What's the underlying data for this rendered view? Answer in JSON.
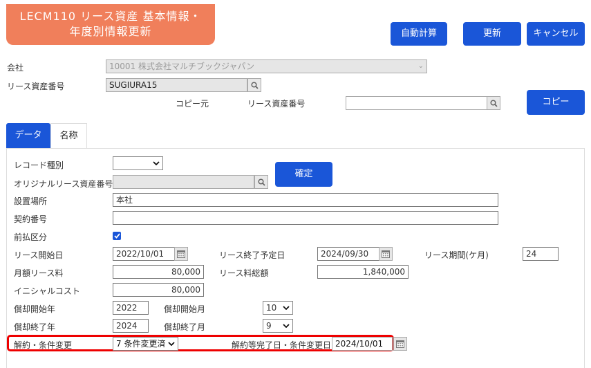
{
  "header": {
    "title_line1": "LECM110 リース資産 基本情報・",
    "title_line2": "年度別情報更新",
    "auto_calc_label": "自動計算",
    "update_label": "更新",
    "cancel_label": "キャンセル"
  },
  "company": {
    "label": "会社",
    "value": "10001 株式会社マルチブックジャパン"
  },
  "asset_no": {
    "label": "リース資産番号",
    "value": "SUGIURA15"
  },
  "copy_source": {
    "label": "コピー元",
    "asset_label": "リース資産番号",
    "value": "",
    "button_label": "コピー"
  },
  "tabs": [
    {
      "label": "データ"
    },
    {
      "label": "名称"
    }
  ],
  "form": {
    "record_type": {
      "label": "レコード種別",
      "value": ""
    },
    "original_asset_no": {
      "label": "オリジナルリース資産番号",
      "value": ""
    },
    "confirm_label": "確定",
    "location": {
      "label": "設置場所",
      "value": "本社"
    },
    "contract_no": {
      "label": "契約番号",
      "value": ""
    },
    "prepaid": {
      "label": "前払区分",
      "checked": true
    },
    "lease_start": {
      "label": "リース開始日",
      "value": "2022/10/01"
    },
    "lease_end_planned": {
      "label": "リース終了予定日",
      "value": "2024/09/30"
    },
    "lease_period": {
      "label": "リース期間(ケ月)",
      "value": "24"
    },
    "monthly_fee": {
      "label": "月額リース料",
      "value": "80,000"
    },
    "total_fee": {
      "label": "リース料総額",
      "value": "1,840,000"
    },
    "initial_cost": {
      "label": "イニシャルコスト",
      "value": "80,000"
    },
    "dep_start_year": {
      "label": "償却開始年",
      "value": "2022"
    },
    "dep_start_month": {
      "label": "償却開始月",
      "value": "10"
    },
    "dep_end_year": {
      "label": "償却終了年",
      "value": "2024"
    },
    "dep_end_month": {
      "label": "償却終了月",
      "value": "9"
    },
    "termination": {
      "label": "解約・条件変更",
      "value": "7 条件変更済"
    },
    "termination_date": {
      "label": "解約等完了日・条件変更日",
      "value": "2024/10/01"
    }
  },
  "colors": {
    "accent": "#1a56d8",
    "title_bg": "#f07f5b",
    "highlight": "#e00000"
  }
}
